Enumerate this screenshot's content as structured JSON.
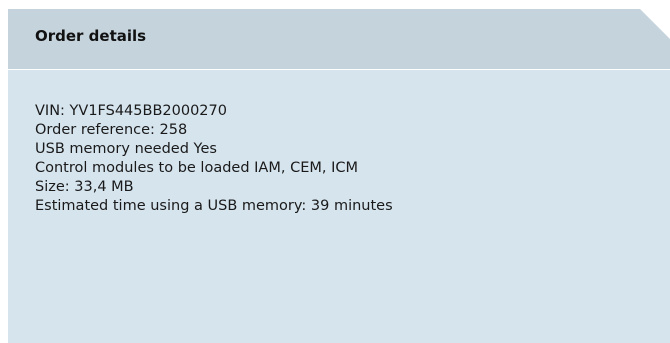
{
  "panel": {
    "title": "Order details",
    "lines": [
      "VIN: YV1FS445BB2000270",
      "Order reference: 258",
      "USB memory needed Yes",
      "Control modules to be loaded IAM, CEM, ICM",
      "Size: 33,4 MB",
      "Estimated time using a USB memory: 39 minutes"
    ]
  },
  "colors": {
    "panel_background": "#d6e4ee",
    "header_background": "#c5d3dd",
    "text": "#1a1a1a"
  }
}
